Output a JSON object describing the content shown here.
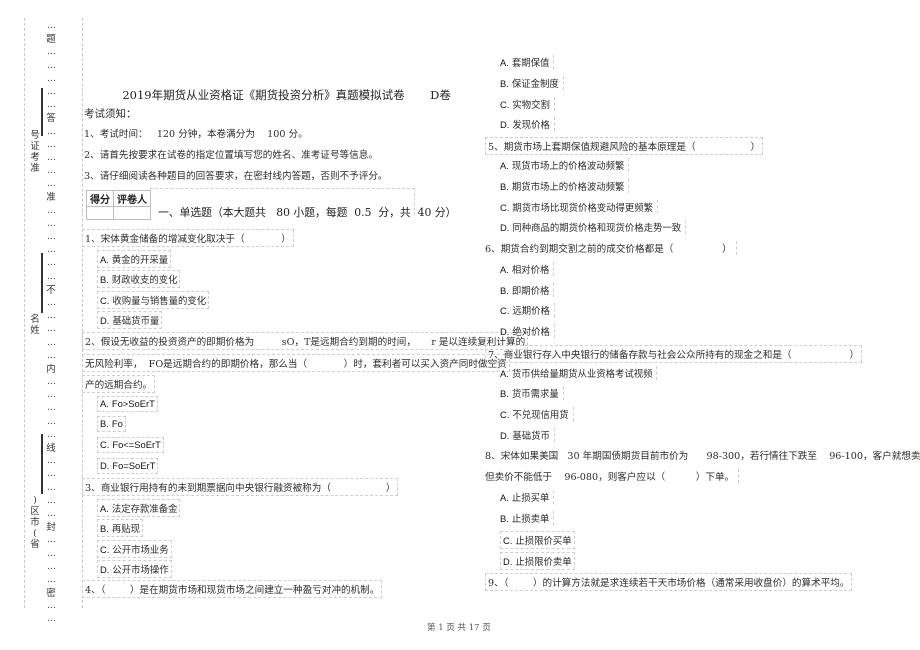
{
  "binding_margin": {
    "seal_chars": [
      "题",
      "答",
      "准",
      "不",
      "内",
      "线",
      "封",
      "密"
    ],
    "fields": [
      {
        "label": "准考证号",
        "chars": [
          "号",
          "证",
          "考",
          "准"
        ]
      },
      {
        "label": "姓名",
        "chars": [
          "名",
          "姓"
        ]
      },
      {
        "label": "省（市区）",
        "chars": [
          ")",
          "区",
          "市",
          "(",
          "省"
        ]
      }
    ],
    "dots": "…"
  },
  "document": {
    "title": "2019年期货从业资格证《期货投资分析》真题模拟试卷",
    "title_suffix": "D卷",
    "notice_heading": "考试须知：",
    "notices": [
      "1、考试时间：   120 分钟，本卷满分为    100 分。",
      "2、请首先按要求在试卷的指定位置填写您的姓名、准考证号等信息。",
      "3、请仔细阅读各种题目的回答要求，在密封线内答题，否则不予评分。"
    ],
    "score_table": {
      "headers": [
        "得分",
        "评卷人"
      ]
    },
    "section_heading": "一、单选题（本大题共   80 小题，每题  0.5  分，共  40 分）"
  },
  "questions_left": [
    {
      "stem_lines": [
        "1、宋体黄金储备的增减变化取决于（            ）"
      ],
      "options": [
        {
          "letter": "A.",
          "text": "黄金的开采量"
        },
        {
          "letter": "B.",
          "text": "财政收支的变化"
        },
        {
          "letter": "C.",
          "text": "收购量与销售量的变化"
        },
        {
          "letter": "D.",
          "text": "基础货币量"
        }
      ]
    },
    {
      "stem_lines": [
        "2、假设无收益的投资资产的即期价格为         sO，T是远期合约到期的时间，     r 是以连续复利计算的",
        "无风险利率，  FO是远期合约的即期价格，那么当（            ）时，套利者可以买入资产同时做空资",
        "产的远期合约。"
      ],
      "options": [
        {
          "letter": "A.",
          "text": "Fo>SoErT"
        },
        {
          "letter": "B.",
          "text": "Fo"
        },
        {
          "letter": "C.",
          "text": "Fo<=SoErT"
        },
        {
          "letter": "D.",
          "text": "Fo=SoErT"
        }
      ]
    },
    {
      "stem_lines": [
        "3、商业银行用持有的未到期票据向中央银行融资被称为（                  ）"
      ],
      "options": [
        {
          "letter": "A.",
          "text": "法定存款准备金"
        },
        {
          "letter": "B.",
          "text": "再贴现"
        },
        {
          "letter": "C.",
          "text": "公开市场业务"
        },
        {
          "letter": "D.",
          "text": "公开市场操作"
        }
      ]
    },
    {
      "stem_lines": [
        "4、（        ）是在期货市场和现货市场之间建立一种盈亏对冲的机制。"
      ],
      "options": []
    }
  ],
  "questions_right": [
    {
      "stem_lines": [],
      "options": [
        {
          "letter": "A.",
          "text": "套期保值"
        },
        {
          "letter": "B.",
          "text": "保证金制度"
        },
        {
          "letter": "C.",
          "text": "实物交割"
        },
        {
          "letter": "D.",
          "text": "发现价格"
        }
      ]
    },
    {
      "stem_lines": [
        "5、期货市场上套期保值规避风险的基本原理是（                  ）"
      ],
      "options": [
        {
          "letter": "A.",
          "text": "现货市场上的价格波动频繁"
        },
        {
          "letter": "B.",
          "text": "期货市场上的价格波动频繁"
        },
        {
          "letter": "C.",
          "text": "期货市场比现货价格变动得更频繁"
        },
        {
          "letter": "D.",
          "text": "同种商品的期货价格和现货价格走势一致"
        }
      ]
    },
    {
      "stem_lines": [
        "6、期货合约到期交割之前的成交价格都是（                ）"
      ],
      "options": [
        {
          "letter": "A.",
          "text": "相对价格"
        },
        {
          "letter": "B.",
          "text": "即期价格"
        },
        {
          "letter": "C.",
          "text": "远期价格"
        },
        {
          "letter": "D.",
          "text": "绝对价格"
        }
      ]
    },
    {
      "stem_lines": [
        "7、商业银行存入中央银行的储备存款与社会公众所持有的现金之和是（                   ）"
      ],
      "options": [
        {
          "letter": "A.",
          "text": "货币供给量期货从业资格考试视频"
        },
        {
          "letter": "B.",
          "text": "货币需求量"
        },
        {
          "letter": "C.",
          "text": "不兑现信用货"
        },
        {
          "letter": "D.",
          "text": "基础货币"
        }
      ]
    },
    {
      "stem_lines": [
        "8、宋体如果美国   30 年期国债期货目前市价为      98-300，若行情往下跌至    96-100，客户就想卖出，",
        "但卖价不能低于    96-080，则客户应以（          ）下单。"
      ],
      "options": [
        {
          "letter": "A.",
          "text": "止损买单"
        },
        {
          "letter": "B.",
          "text": "止损卖单"
        },
        {
          "letter": "C.",
          "text": "止损限价买单"
        },
        {
          "letter": "D.",
          "text": "止损限价卖单"
        }
      ]
    },
    {
      "stem_lines": [
        "9、（        ）的计算方法就是求连续若干天市场价格（通常采用收盘价）的算术平均。"
      ],
      "options": []
    }
  ],
  "footer": {
    "text": "第 1 页 共 17 页"
  }
}
